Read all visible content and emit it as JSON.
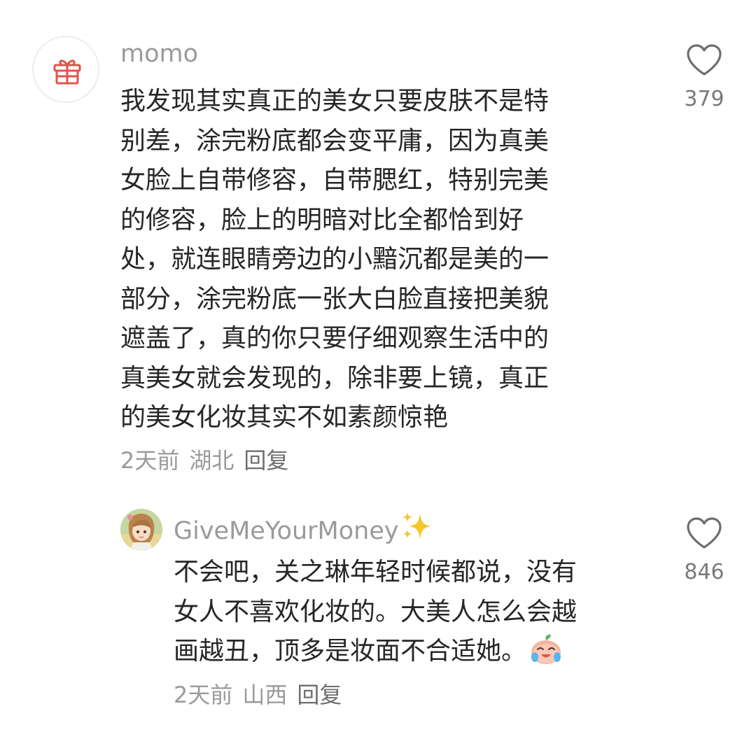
{
  "comments": [
    {
      "username": "momo",
      "avatar_icon": "gift-icon",
      "text_lines": [
        "我发现其实真正的美女只要皮肤不是特",
        "别差，涂完粉底都会变平庸，因为真美",
        "女脸上自带修容，自带腮红，特别完美",
        "的修容，脸上的明暗对比全都恰到好",
        "处，就连眼睛旁边的小黯沉都是美的一",
        "部分，涂完粉底一张大白脸直接把美貌",
        "遮盖了，真的你只要仔细观察生活中的",
        "真美女就会发现的，除非要上镜，真正",
        "的美女化妆其实不如素颜惊艳"
      ],
      "time": "2天前",
      "location": "湖北",
      "reply_label": "回复",
      "like_count": "379"
    },
    {
      "username": "GiveMeYourMoney",
      "username_emoji": "sparkles",
      "avatar_icon": "anime-girl-avatar",
      "text_lines": [
        "不会吧，关之琳年轻时候都说，没有",
        "女人不喜欢化妆的。大美人怎么会越",
        "画越丑，顶多是妆面不合适她。"
      ],
      "text_emoji": "crying-laughing-peach",
      "time": "2天前",
      "location": "山西",
      "reply_label": "回复",
      "like_count": "846"
    }
  ],
  "colors": {
    "text": "#262626",
    "secondary": "#9a9a9a",
    "icon": "#6e6e6e",
    "gift": "#e0544a"
  }
}
